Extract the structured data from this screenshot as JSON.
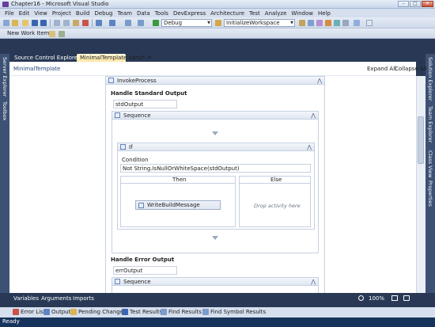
{
  "window": {
    "title": "Chapter16 - Microsoft Visual Studio",
    "min": "–",
    "max": "□",
    "close": "✕"
  },
  "menu": [
    "File",
    "Edit",
    "View",
    "Project",
    "Build",
    "Debug",
    "Team",
    "Data",
    "Tools",
    "DevExpress",
    "Architecture",
    "Test",
    "Analyze",
    "Window",
    "Help"
  ],
  "toolbar": {
    "config": "Debug",
    "target": "InitializeWorkspace",
    "new_work_item": "New Work Item ▾"
  },
  "doc_tabs": {
    "inactive": "Source Control Explorer",
    "active": "MinimalTemplate.xaml*",
    "close": "✕"
  },
  "left_rail": [
    "Server Explorer",
    "Toolbox"
  ],
  "right_rail": [
    "Solution Explorer",
    "Team Explorer",
    "Class View",
    "Properties"
  ],
  "designer": {
    "breadcrumb": "MinimalTemplate",
    "expand_all": "Expand All",
    "collapse_all": "Collapse All",
    "invoke_process": "InvokeProcess",
    "handle_std_out": "Handle Standard Output",
    "std_output_var": "stdOutput",
    "sequence": "Sequence",
    "if_label": "If",
    "condition_label": "Condition",
    "condition_value": "Not String.IsNullOrWhiteSpace(stdOutput)",
    "then_label": "Then",
    "else_label": "Else",
    "write_build_message": "WriteBuildMessage",
    "drop_hint": "Drop activity here",
    "handle_err_out": "Handle Error Output",
    "err_output_var": "errOutput",
    "sequence2": "Sequence",
    "collapse_glyph": "⋀"
  },
  "bottom_tabs": {
    "variables": "Variables",
    "arguments": "Arguments",
    "imports": "Imports",
    "zoom": "100%"
  },
  "panels": [
    "Error List",
    "Output",
    "Pending Changes",
    "Test Results",
    "Find Results 1",
    "Find Symbol Results"
  ],
  "status": "Ready",
  "colors": {
    "chrome": "#293955",
    "active_tab": "#ffe8a6",
    "status_bar": "#16335b"
  }
}
